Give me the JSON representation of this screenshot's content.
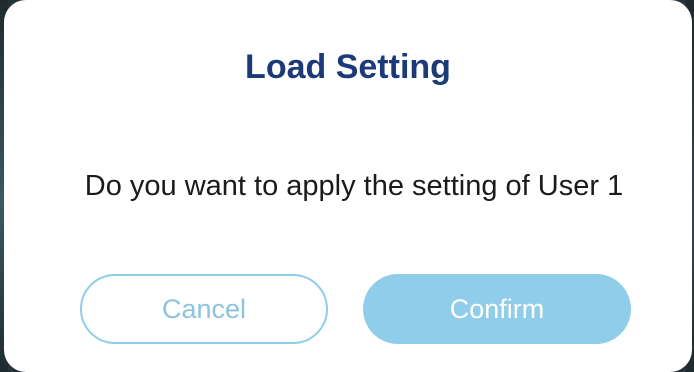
{
  "dialog": {
    "title": "Load Setting",
    "message": "Do you want to apply the setting of User 1",
    "cancel_label": "Cancel",
    "confirm_label": "Confirm"
  },
  "colors": {
    "title": "#1d3a78",
    "accent": "#8fcdea",
    "background": "#ffffff"
  }
}
